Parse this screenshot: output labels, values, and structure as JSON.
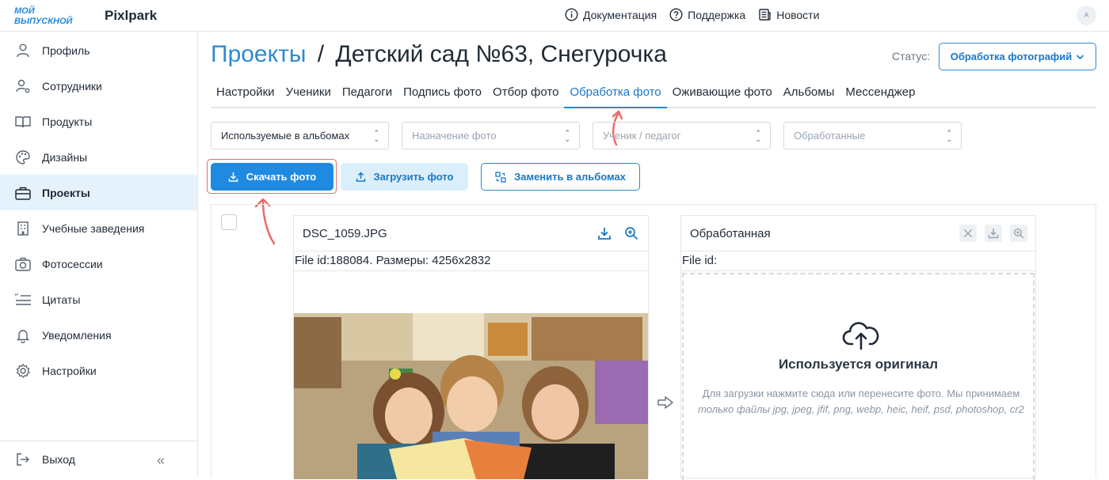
{
  "header": {
    "logo_text": "МОЙ ВЫПУСКНОЙ",
    "brand": "Pixlpark",
    "nav": [
      {
        "label": "Документация",
        "icon": "info-icon"
      },
      {
        "label": "Поддержка",
        "icon": "help-icon"
      },
      {
        "label": "Новости",
        "icon": "news-icon"
      }
    ],
    "avatar_initial": "A"
  },
  "sidebar": {
    "items": [
      {
        "label": "Профиль",
        "icon": "user-icon"
      },
      {
        "label": "Сотрудники",
        "icon": "users-gear-icon"
      },
      {
        "label": "Продукты",
        "icon": "book-icon"
      },
      {
        "label": "Дизайны",
        "icon": "palette-icon"
      },
      {
        "label": "Проекты",
        "icon": "briefcase-icon",
        "active": true
      },
      {
        "label": "Учебные заведения",
        "icon": "building-icon"
      },
      {
        "label": "Фотосессии",
        "icon": "camera-icon"
      },
      {
        "label": "Цитаты",
        "icon": "quote-icon"
      },
      {
        "label": "Уведомления",
        "icon": "bell-icon"
      },
      {
        "label": "Настройки",
        "icon": "gear-icon"
      }
    ],
    "logout": "Выход",
    "collapse": "«"
  },
  "page": {
    "breadcrumb": "Проекты",
    "separator": "/",
    "title": "Детский сад №63, Снегурочка",
    "status_label": "Статус:",
    "status_value": "Обработка фотографий"
  },
  "tabs": [
    {
      "label": "Настройки"
    },
    {
      "label": "Ученики"
    },
    {
      "label": "Педагоги"
    },
    {
      "label": "Подпись фото"
    },
    {
      "label": "Отбор фото"
    },
    {
      "label": "Обработка фото",
      "active": true
    },
    {
      "label": "Оживающие фото"
    },
    {
      "label": "Альбомы"
    },
    {
      "label": "Мессенджер"
    }
  ],
  "filters": [
    {
      "value": "Используемые в альбомах",
      "placeholder": false
    },
    {
      "value": "Назначение фото",
      "placeholder": true
    },
    {
      "value": "Ученик / педагог",
      "placeholder": true
    },
    {
      "value": "Обработанные",
      "placeholder": true
    }
  ],
  "actions": {
    "download": "Скачать фото",
    "upload": "Загрузить фото",
    "replace": "Заменить в альбомах"
  },
  "original_card": {
    "filename": "DSC_1059.JPG",
    "meta": "File id:188084. Размеры: 4256x2832"
  },
  "processed_card": {
    "title": "Обработанная",
    "meta": "File id:",
    "dz_title": "Используется оригинал",
    "dz_text_1": "Для загрузки нажмите сюда или перенесите фото. Мы принимаем",
    "dz_text_2": "только файлы jpg, jpeg, jfif, png, webp, heic, heif, psd, photoshop, cr2"
  },
  "colors": {
    "accent": "#1f8ae0",
    "accent_text": "#1878c6",
    "annotation": "#ee6a6a"
  }
}
